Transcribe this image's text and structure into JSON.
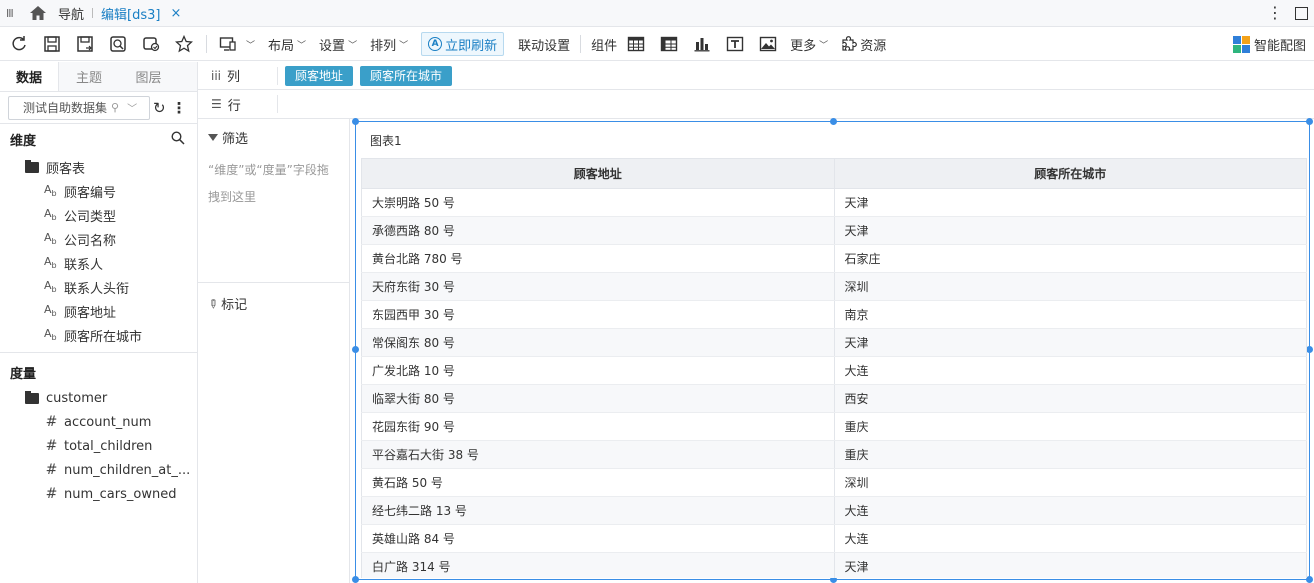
{
  "tabbar": {
    "home_label": "导航",
    "active_tab": "编辑[ds3]",
    "close": "×"
  },
  "toolbar": {
    "layout": "布局",
    "settings": "设置",
    "arrange": "排列",
    "refresh_now": "立即刷新",
    "linkage": "联动设置",
    "components": "组件",
    "more": "更多",
    "resources": "资源",
    "smart_chart": "智能配图"
  },
  "left": {
    "tabs": [
      "数据",
      "主题",
      "图层"
    ],
    "datasource": "测试自助数据集",
    "dimensions_title": "维度",
    "dim_folder": "顾客表",
    "dim_fields": [
      "顾客编号",
      "公司类型",
      "公司名称",
      "联系人",
      "联系人头衔",
      "顾客地址",
      "顾客所在城市"
    ],
    "measures_title": "度量",
    "measure_folder": "customer",
    "measure_fields": [
      "account_num",
      "total_children",
      "num_children_at_...",
      "num_cars_owned"
    ]
  },
  "shelf": {
    "col_label": "列",
    "row_label": "行",
    "col_pills": [
      "顾客地址",
      "顾客所在城市"
    ]
  },
  "filter": {
    "title": "筛选",
    "hint": "“维度”或“度量”字段拖拽到这里"
  },
  "marks": {
    "title": "标记"
  },
  "chart": {
    "title": "图表1",
    "columns": [
      "顾客地址",
      "顾客所在城市"
    ],
    "rows": [
      [
        "大崇明路 50 号",
        "天津"
      ],
      [
        "承德西路 80 号",
        "天津"
      ],
      [
        "黄台北路 780 号",
        "石家庄"
      ],
      [
        "天府东街 30 号",
        "深圳"
      ],
      [
        "东园西甲 30 号",
        "南京"
      ],
      [
        "常保阁东 80 号",
        "天津"
      ],
      [
        "广发北路 10 号",
        "大连"
      ],
      [
        "临翠大街 80 号",
        "西安"
      ],
      [
        "花园东街 90 号",
        "重庆"
      ],
      [
        "平谷嘉石大街 38 号",
        "重庆"
      ],
      [
        "黄石路 50 号",
        "深圳"
      ],
      [
        "经七纬二路 13 号",
        "大连"
      ],
      [
        "英雄山路 84 号",
        "大连"
      ],
      [
        "白广路 314 号",
        "天津"
      ]
    ]
  }
}
